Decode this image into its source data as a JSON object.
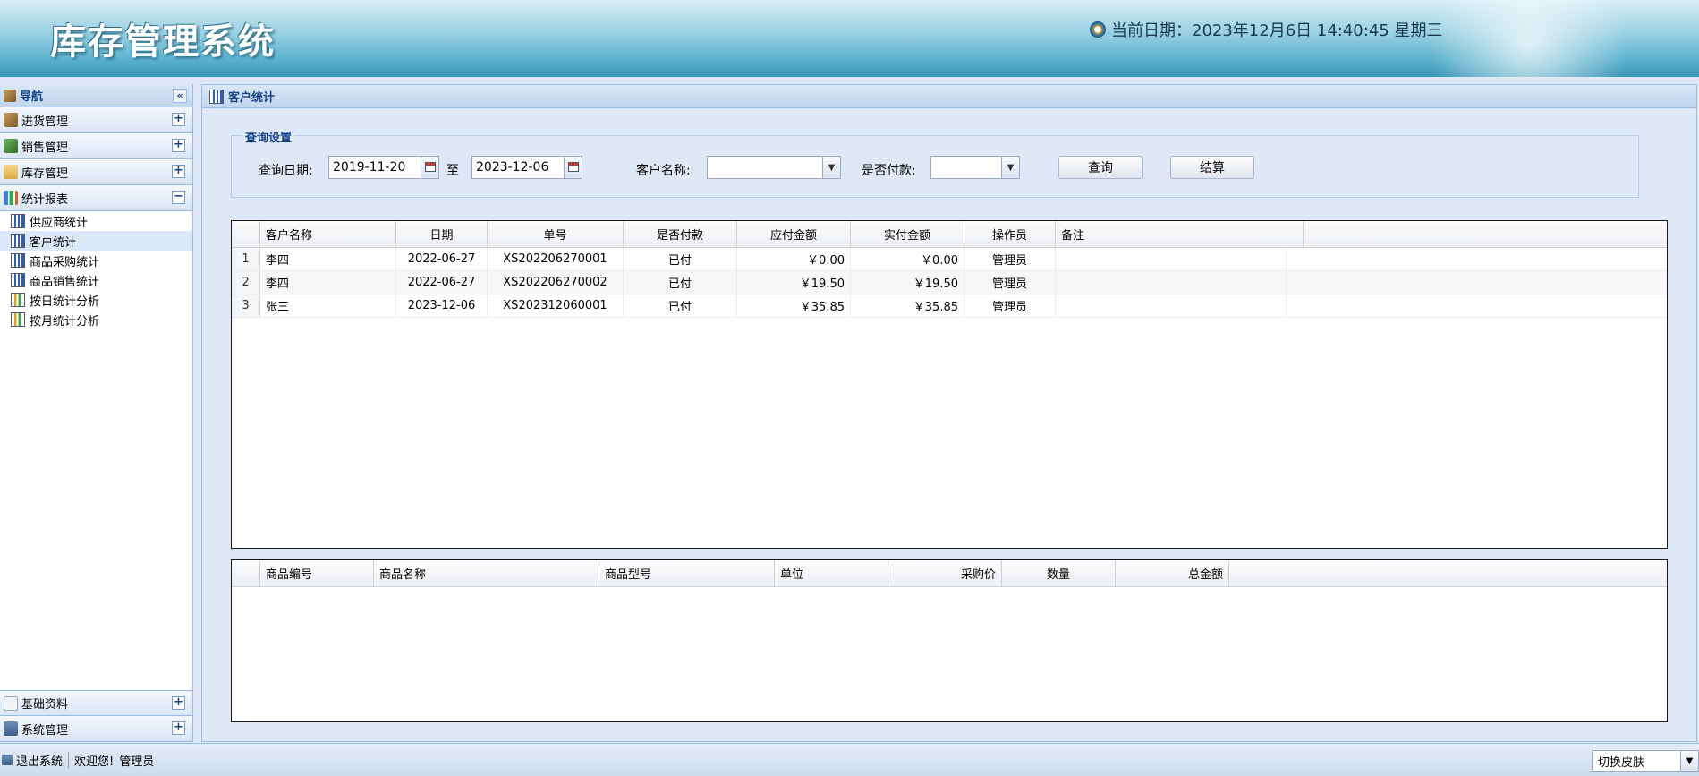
{
  "header": {
    "app_title": "库存管理系统",
    "date_label": "当前日期：2023年12月6日 14:40:45 星期三"
  },
  "sidebar": {
    "title": "导航",
    "collapse_symbol": "«",
    "sections_top": [
      {
        "label": "进货管理",
        "toggle": "+"
      },
      {
        "label": "销售管理",
        "toggle": "+"
      },
      {
        "label": "库存管理",
        "toggle": "+"
      },
      {
        "label": "统计报表",
        "toggle": "−"
      }
    ],
    "report_items": [
      {
        "label": "供应商统计"
      },
      {
        "label": "客户统计"
      },
      {
        "label": "商品采购统计"
      },
      {
        "label": "商品销售统计"
      },
      {
        "label": "按日统计分析"
      },
      {
        "label": "按月统计分析"
      }
    ],
    "sections_bottom": [
      {
        "label": "基础资料",
        "toggle": "+"
      },
      {
        "label": "系统管理",
        "toggle": "+"
      }
    ]
  },
  "main": {
    "tab_title": "客户统计",
    "query": {
      "legend": "查询设置",
      "date_label": "查询日期:",
      "start_date": "2019-11-20",
      "to_label": "至",
      "end_date": "2023-12-06",
      "customer_label": "客户名称:",
      "customer_value": "",
      "paid_label": "是否付款:",
      "paid_value": "",
      "query_button": "查询",
      "settle_button": "结算"
    },
    "orders": {
      "columns": [
        "客户名称",
        "日期",
        "单号",
        "是否付款",
        "应付金额",
        "实付金额",
        "操作员",
        "备注"
      ],
      "rows": [
        {
          "num": "1",
          "customer": "李四",
          "date": "2022-06-27",
          "order_no": "XS202206270001",
          "paid": "已付",
          "due": "￥0.00",
          "actual": "￥0.00",
          "operator": "管理员",
          "note": ""
        },
        {
          "num": "2",
          "customer": "李四",
          "date": "2022-06-27",
          "order_no": "XS202206270002",
          "paid": "已付",
          "due": "￥19.50",
          "actual": "￥19.50",
          "operator": "管理员",
          "note": ""
        },
        {
          "num": "3",
          "customer": "张三",
          "date": "2023-12-06",
          "order_no": "XS202312060001",
          "paid": "已付",
          "due": "￥35.85",
          "actual": "￥35.85",
          "operator": "管理员",
          "note": ""
        }
      ]
    },
    "details": {
      "columns": [
        "商品编号",
        "商品名称",
        "商品型号",
        "单位",
        "采购价",
        "数量",
        "总金额"
      ]
    }
  },
  "footer": {
    "logout": "退出系统",
    "welcome": "欢迎您!",
    "user": "管理员",
    "skin_label": "切换皮肤"
  }
}
